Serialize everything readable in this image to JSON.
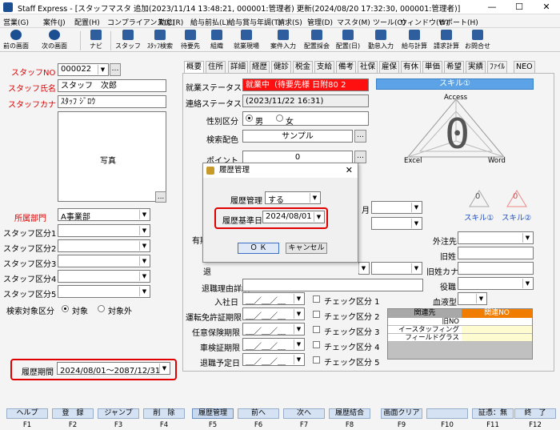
{
  "window": {
    "title": "Staff Express - [スタッフマスタ 追加(2023/11/14 13:48:21, 000001:管理者) 更新(2024/08/20 17:32:30, 000001:管理者)]",
    "minimize": "—",
    "maximize": "☐",
    "close": "✕"
  },
  "menu": [
    "営業(G)",
    "案件(J)",
    "配置(H)",
    "コンプライアンス(C)",
    "勤怠(R)",
    "給与前払(L)",
    "給与賞与年調(T)",
    "請求(S)",
    "管理(D)",
    "マスタ(M)",
    "ツール(O)",
    "ウィンドウ(W)",
    "サポート(H)"
  ],
  "toolbar": {
    "prev": "前の画面",
    "next": "次の画面",
    "navi": "ナビ",
    "staff": "スタッフ",
    "staff_search": "ｽﾀｯﾌ検索",
    "taiki": "待要先",
    "soshiki": "組織",
    "genba": "就業現場",
    "anken_input": "案件入力",
    "haichi_kaigi": "配置採会",
    "haichi_bi": "配置(日)",
    "kintai_input": "勤怠入力",
    "kyuyo_calc": "給与計算",
    "seikyu_calc": "請求計算",
    "info": "お問合せ"
  },
  "form": {
    "staff_no_label": "スタッフNO",
    "staff_no": "000022",
    "name_label": "スタッフ氏名",
    "name": "スタッフ　次郎",
    "kana_label": "スタッフカナ",
    "kana": "ｽﾀｯﾌ ｼﾞﾛｳ",
    "photo_label": "写真",
    "photo_btn": "...",
    "dept_label": "所属部門",
    "dept": "A事業部",
    "kubun1": "スタッフ区分1",
    "kubun2": "スタッフ区分2",
    "kubun3": "スタッフ区分3",
    "kubun4": "スタッフ区分4",
    "kubun5": "スタッフ区分5",
    "search_target_label": "検索対象区分",
    "target": "対象",
    "not_target": "対象外",
    "history_period_label": "履歴期間",
    "history_period": "2024/08/01～2087/12/31"
  },
  "tabs": [
    "概要",
    "住所",
    "詳細",
    "経歴",
    "健診",
    "税金",
    "支給",
    "備考",
    "社保",
    "雇保",
    "有休",
    "単価",
    "希望",
    "実績",
    "ﾌｧｲﾙ",
    "NEO"
  ],
  "detail": {
    "work_status_label": "就業ステータス",
    "work_status": "就業中（待要先様 日附80 2",
    "contact_status_label": "連絡ステータス",
    "contact_status": "(2023/11/22 16:31)",
    "gender_label": "性別区分",
    "male": "男",
    "female": "女",
    "color_label": "検索配色",
    "color_value": "サンプル",
    "point_label": "ポイント",
    "point_value": "0",
    "partial_label": "有期",
    "partial_entry": "入",
    "partial_month": "月",
    "partial_ret": "退",
    "retire_detail_label": "退職理由詳細",
    "join_label": "入社日",
    "license_label": "運転免許証期限",
    "insurance_label": "任意保険期限",
    "vehicle_label": "車検証期限",
    "retire_plan_label": "退職予定日",
    "date_blank": "＿／＿／＿",
    "check1": "チェック区分 1",
    "check2": "チェック区分 2",
    "check3": "チェック区分 3",
    "check4": "チェック区分 4",
    "check5": "チェック区分 5",
    "dispatch_label": "外注先",
    "old_name_label": "旧姓",
    "old_kana_label": "旧姓カナ",
    "role_label": "役職",
    "blood_label": "血液型"
  },
  "skill": {
    "header": "スキル①",
    "access": "Access",
    "excel": "Excel",
    "word": "Word",
    "center": "0",
    "skill1": "スキル①",
    "skill2": "スキル②",
    "mini_val": "0"
  },
  "related": {
    "h1": "関連先",
    "h2": "関連NO",
    "rows": [
      "旧NO",
      "イースタッフィング",
      "フィールドグラス"
    ]
  },
  "dialog": {
    "title": "履歴管理",
    "mgmt_label": "履歴管理",
    "mgmt_value": "する",
    "base_date_label": "履歴基準日",
    "base_date": "2024/08/01",
    "ok": "Ｏ Ｋ",
    "cancel": "キャンセル"
  },
  "fkeys": [
    {
      "label": "ヘルプ",
      "key": "F1"
    },
    {
      "label": "登　録",
      "key": "F2"
    },
    {
      "label": "ジャンプ",
      "key": "F3"
    },
    {
      "label": "削　除",
      "key": "F4"
    },
    {
      "label": "履歴管理",
      "key": "F5"
    },
    {
      "label": "前へ",
      "key": "F6"
    },
    {
      "label": "次へ",
      "key": "F7"
    },
    {
      "label": "履歴結合",
      "key": "F8"
    },
    {
      "label": "画面クリア",
      "key": "F9"
    },
    {
      "label": "",
      "key": "F10"
    },
    {
      "label": "証憑：無",
      "key": "F11"
    },
    {
      "label": "終　了",
      "key": "F12"
    }
  ],
  "colors": {
    "accent": "#e00000",
    "skill_header": "#5ba3e6",
    "related_no": "#f07c00"
  }
}
